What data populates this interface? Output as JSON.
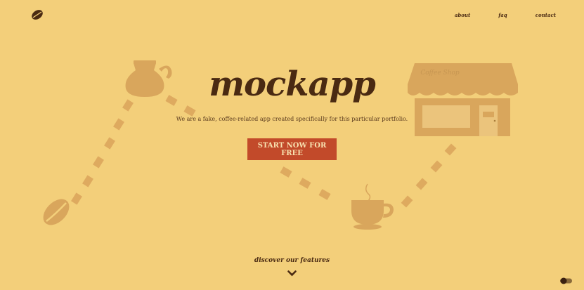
{
  "nav": {
    "about": "about",
    "faq": "faq",
    "contact": "contact"
  },
  "hero": {
    "title": "mockapp",
    "tagline": "We are a fake, coffee-related app created specifically for this particular portfolio.",
    "cta_label": "START NOW FOR FREE"
  },
  "shop_sign": "Coffee Shop",
  "discover_label": "discover our features",
  "icons": {
    "logo": "coffee-bean-icon",
    "kettle": "coffee-pot-icon",
    "shop": "coffee-shop-icon",
    "bean": "coffee-bean-icon",
    "cup": "coffee-cup-icon",
    "chevron": "chevron-down-icon",
    "toggle": "toggle-icon"
  },
  "colors": {
    "background": "#f3cf7a",
    "illustration": "#d9a65c",
    "text": "#4a2a12",
    "cta": "#c24a2a"
  }
}
